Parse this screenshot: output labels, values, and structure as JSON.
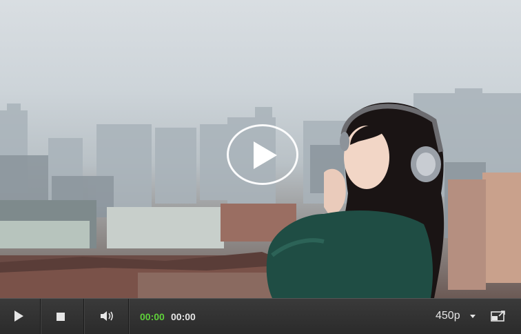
{
  "player": {
    "state": "paused",
    "time": {
      "current": "00:00",
      "total": "00:00"
    },
    "quality": {
      "selected": "450p"
    },
    "colors": {
      "current_time": "#5fd13a",
      "controls_bg": "#2e2e2e",
      "icons": "#e6e6e6"
    },
    "icons": {
      "big_play": "play-circle-icon",
      "play": "play-icon",
      "stop": "stop-icon",
      "volume": "volume-icon",
      "quality_menu": "chevron-down-icon",
      "fullscreen": "fullscreen-icon"
    }
  }
}
